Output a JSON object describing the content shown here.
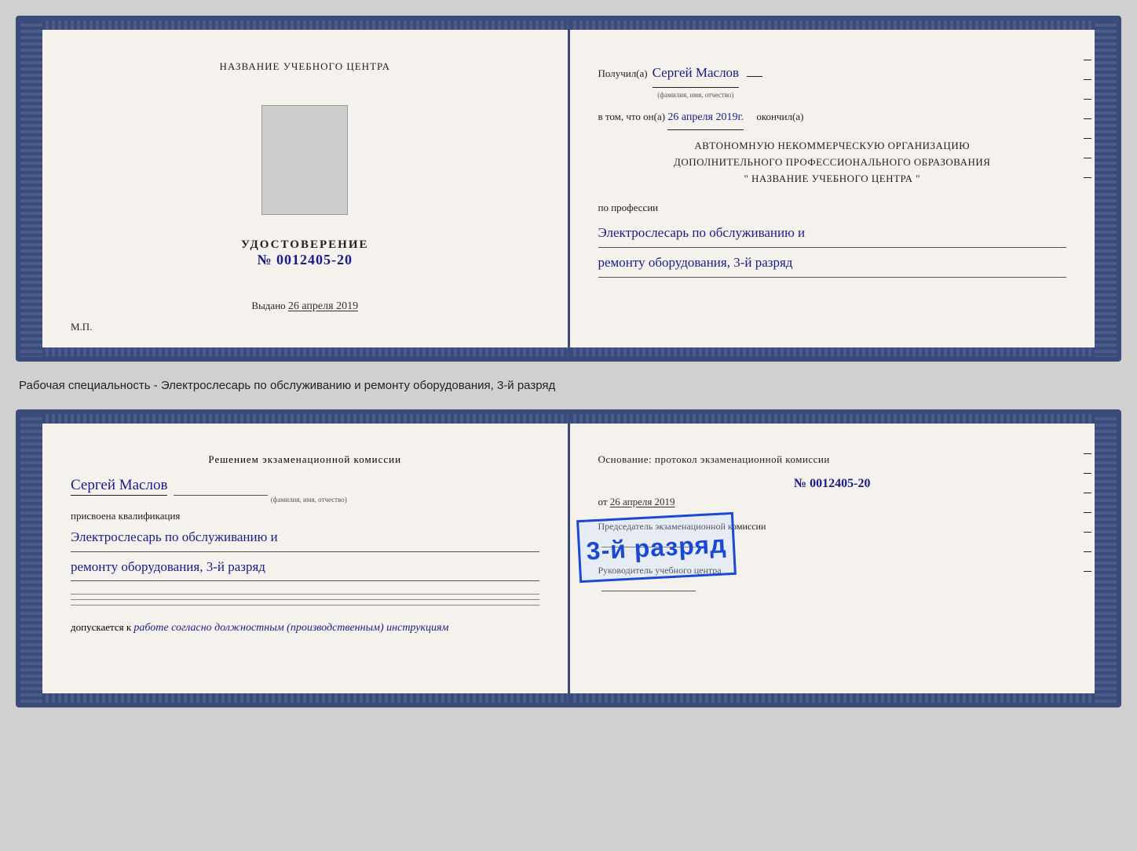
{
  "card1": {
    "left": {
      "center_title": "НАЗВАНИЕ УЧЕБНОГО ЦЕНТРА",
      "photo_alt": "photo placeholder",
      "udostoverenie_label": "УДОСТОВЕРЕНИЕ",
      "doc_number_prefix": "№",
      "doc_number": "0012405-20",
      "vydano_label": "Выдано",
      "vydano_date": "26 апреля 2019",
      "mp_label": "М.П."
    },
    "right": {
      "poluchil_label": "Получил(а)",
      "person_name": "Сергей Маслов",
      "fio_hint": "(фамилия, имя, отчество)",
      "dash": "–",
      "vtom_label": "в том, что он(а)",
      "vtom_date": "26 апреля 2019г.",
      "okochil_label": "окончил(а)",
      "avt_line1": "АВТОНОМНУЮ НЕКОММЕРЧЕСКУЮ ОРГАНИЗАЦИЮ",
      "avt_line2": "ДОПОЛНИТЕЛЬНОГО ПРОФЕССИОНАЛЬНОГО ОБРАЗОВАНИЯ",
      "avt_line3": "\"   НАЗВАНИЕ УЧЕБНОГО ЦЕНТРА   \"",
      "po_professii_label": "по профессии",
      "profession_line1": "Электрослесарь по обслуживанию и",
      "profession_line2": "ремонту оборудования, 3-й разряд"
    }
  },
  "between_text": "Рабочая специальность - Электрослесарь по обслуживанию и ремонту оборудования, 3-й разряд",
  "card2": {
    "left": {
      "resheniem_label": "Решением экзаменационной комиссии",
      "person_name": "Сергей Маслов",
      "fio_hint": "(фамилия, имя, отчество)",
      "prisvoena_label": "присвоена квалификация",
      "profession_line1": "Электрослесарь по обслуживанию и",
      "profession_line2": "ремонту оборудования, 3-й разряд",
      "dopuskaetsya_label": "допускается к",
      "dopuskaetsya_text": "работе согласно должностным (производственным) инструкциям"
    },
    "right": {
      "osnovanie_label": "Основание: протокол экзаменационной комиссии",
      "doc_number_prefix": "№",
      "doc_number": "0012405-20",
      "ot_label": "от",
      "ot_date": "26 апреля 2019",
      "predsedatel_label": "Председатель экзаменационной комиссии",
      "rukovoditel_label": "Руководитель учебного центра"
    },
    "stamp": {
      "line1": "3-й",
      "line2": "разряд"
    }
  }
}
